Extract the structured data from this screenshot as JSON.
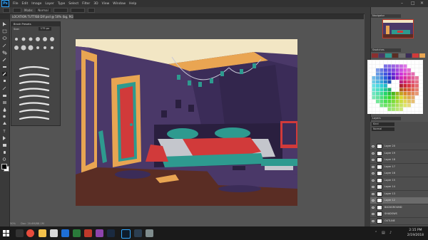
{
  "app": {
    "logo_text": "Ps"
  },
  "menu": [
    "File",
    "Edit",
    "Image",
    "Layer",
    "Type",
    "Select",
    "Filter",
    "3D",
    "View",
    "Window",
    "Help"
  ],
  "window_controls": [
    "–",
    "□",
    "✕"
  ],
  "options": {
    "mode_label": "Mode:",
    "mode_value": "Normal"
  },
  "document": {
    "tab_title": "LOCATION TUTTISB DIY.psd @ 50% (bg, RGB/8) *"
  },
  "brush_panel": {
    "title": "Brush Presets",
    "size_label": "Size:",
    "size_value": "175 px"
  },
  "right_panels": {
    "navigator_tab": "Navigator",
    "swatches_tab": "Swatches",
    "layers_tab": "Layers",
    "blend_mode": "Normal",
    "kind_label": "Kind"
  },
  "layers": [
    {
      "name": "Layer 20",
      "selected": false
    },
    {
      "name": "Layer 19",
      "selected": false
    },
    {
      "name": "Layer 18",
      "selected": false
    },
    {
      "name": "Layer 17",
      "selected": false
    },
    {
      "name": "Layer 16",
      "selected": false
    },
    {
      "name": "Layer 15",
      "selected": false
    },
    {
      "name": "Layer 14",
      "selected": false
    },
    {
      "name": "Layer 13",
      "selected": false
    },
    {
      "name": "Layer 12",
      "selected": true
    },
    {
      "name": "BACKGROUND",
      "selected": false
    },
    {
      "name": "SHADOWS",
      "selected": false
    },
    {
      "name": "OUTLINE",
      "selected": false
    }
  ],
  "status": {
    "zoom": "50%",
    "doc_info": "Doc: 20.6M/88.1M"
  },
  "taskbar": {
    "time": "2:15 PM",
    "date": "2/19/2018"
  },
  "colors": {
    "accent_red": "#d13a3a",
    "teal": "#2e9a8f",
    "wall_purple": "#4a3868",
    "floor_brown": "#5a2d24",
    "door_orange": "#e8a552",
    "selection_blue": "#31a8ff"
  }
}
